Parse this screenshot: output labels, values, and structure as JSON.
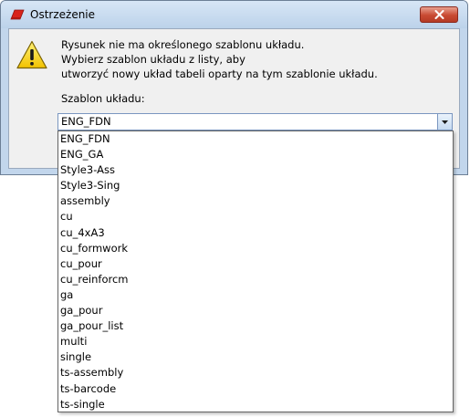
{
  "window": {
    "title": "Ostrzeżenie",
    "icons": {
      "app": "app-icon",
      "close": "close-icon",
      "warning": "warning-icon",
      "dropdown": "chevron-down-icon"
    },
    "colors": {
      "frame": "#c2d6ec",
      "client": "#f0f0f0",
      "close_button": "#c94a32"
    }
  },
  "message": {
    "line1": "Rysunek nie ma określonego szablonu układu.",
    "line2": "Wybierz szablon układu z listy, aby",
    "line3": "utworzyć nowy układ tabeli oparty na tym szablonie układu."
  },
  "layout_template": {
    "label": "Szablon układu:",
    "selected": "ENG_FDN",
    "options": [
      "ENG_FDN",
      "ENG_GA",
      "Style3-Ass",
      "Style3-Sing",
      "assembly",
      "cu",
      "cu_4xA3",
      "cu_formwork",
      "cu_pour",
      "cu_reinforcm",
      "ga",
      "ga_pour",
      "ga_pour_list",
      "multi",
      "single",
      "ts-assembly",
      "ts-barcode",
      "ts-single"
    ]
  }
}
